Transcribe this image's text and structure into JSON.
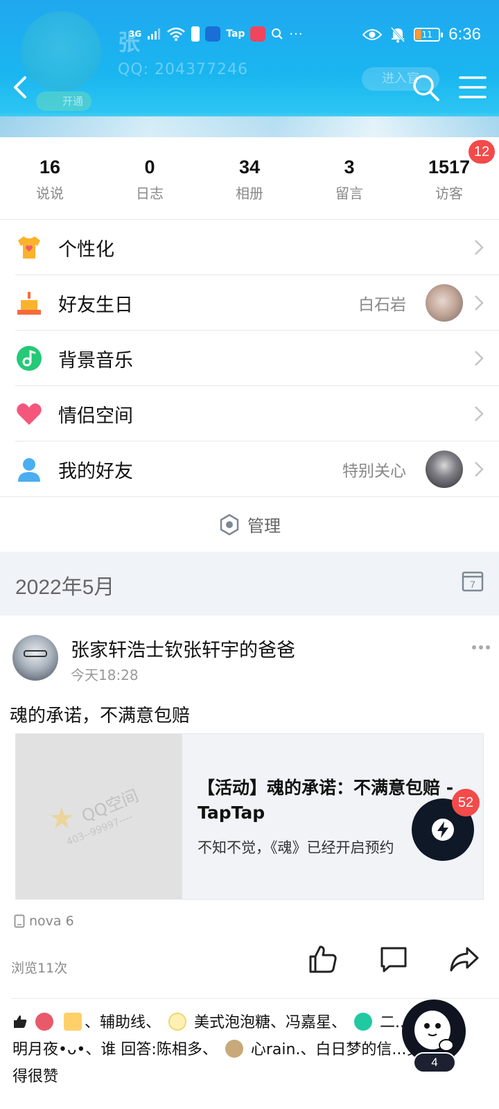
{
  "header": {
    "name_partial": "张",
    "qq_line": "QQ: 204377246",
    "vip_label": "开通",
    "enter_label": "进入官"
  },
  "status_bar": {
    "network": "3G",
    "tap_label": "Tap",
    "battery": "11",
    "time": "6:36"
  },
  "stats": [
    {
      "num": "16",
      "label": "说说"
    },
    {
      "num": "0",
      "label": "日志"
    },
    {
      "num": "34",
      "label": "相册"
    },
    {
      "num": "3",
      "label": "留言"
    },
    {
      "num": "1517",
      "label": "访客",
      "badge": "12"
    }
  ],
  "menu": [
    {
      "label": "个性化",
      "sub": ""
    },
    {
      "label": "好友生日",
      "sub": "白石岩"
    },
    {
      "label": "背景音乐",
      "sub": ""
    },
    {
      "label": "情侣空间",
      "sub": ""
    },
    {
      "label": "我的好友",
      "sub": "特别关心"
    }
  ],
  "manage_label": "管理",
  "month": "2022年5月",
  "post": {
    "author": "张家轩浩士钦张轩宇的爸爸",
    "time": "今天18:28",
    "text": "魂的承诺，不满意包赔",
    "link_title": "【活动】魂的承诺：不满意包赔 - TapTap",
    "link_desc": "不知不觉，《魂》已经开启预约",
    "watermark": "QQ空间",
    "watermark_sub": "403--99997----",
    "device": "nova 6",
    "views": "浏览11次",
    "likes_text_1": "、辅助线、",
    "likes_text_2": "美式泡泡糖、冯嘉星、",
    "likes_text_3": "二...桥",
    "likes_text_4": "明月夜•ᴗ•、谁 回答:陈相多、",
    "likes_text_5": "心rain.、白日梦的信...觉",
    "likes_text_6": "得很赞"
  },
  "floating": {
    "chat_badge": "52",
    "mascot_count": "4"
  },
  "colors": {
    "header_blue": "#20a8ef",
    "badge_red": "#f34a4a",
    "text_gray": "#888888"
  }
}
